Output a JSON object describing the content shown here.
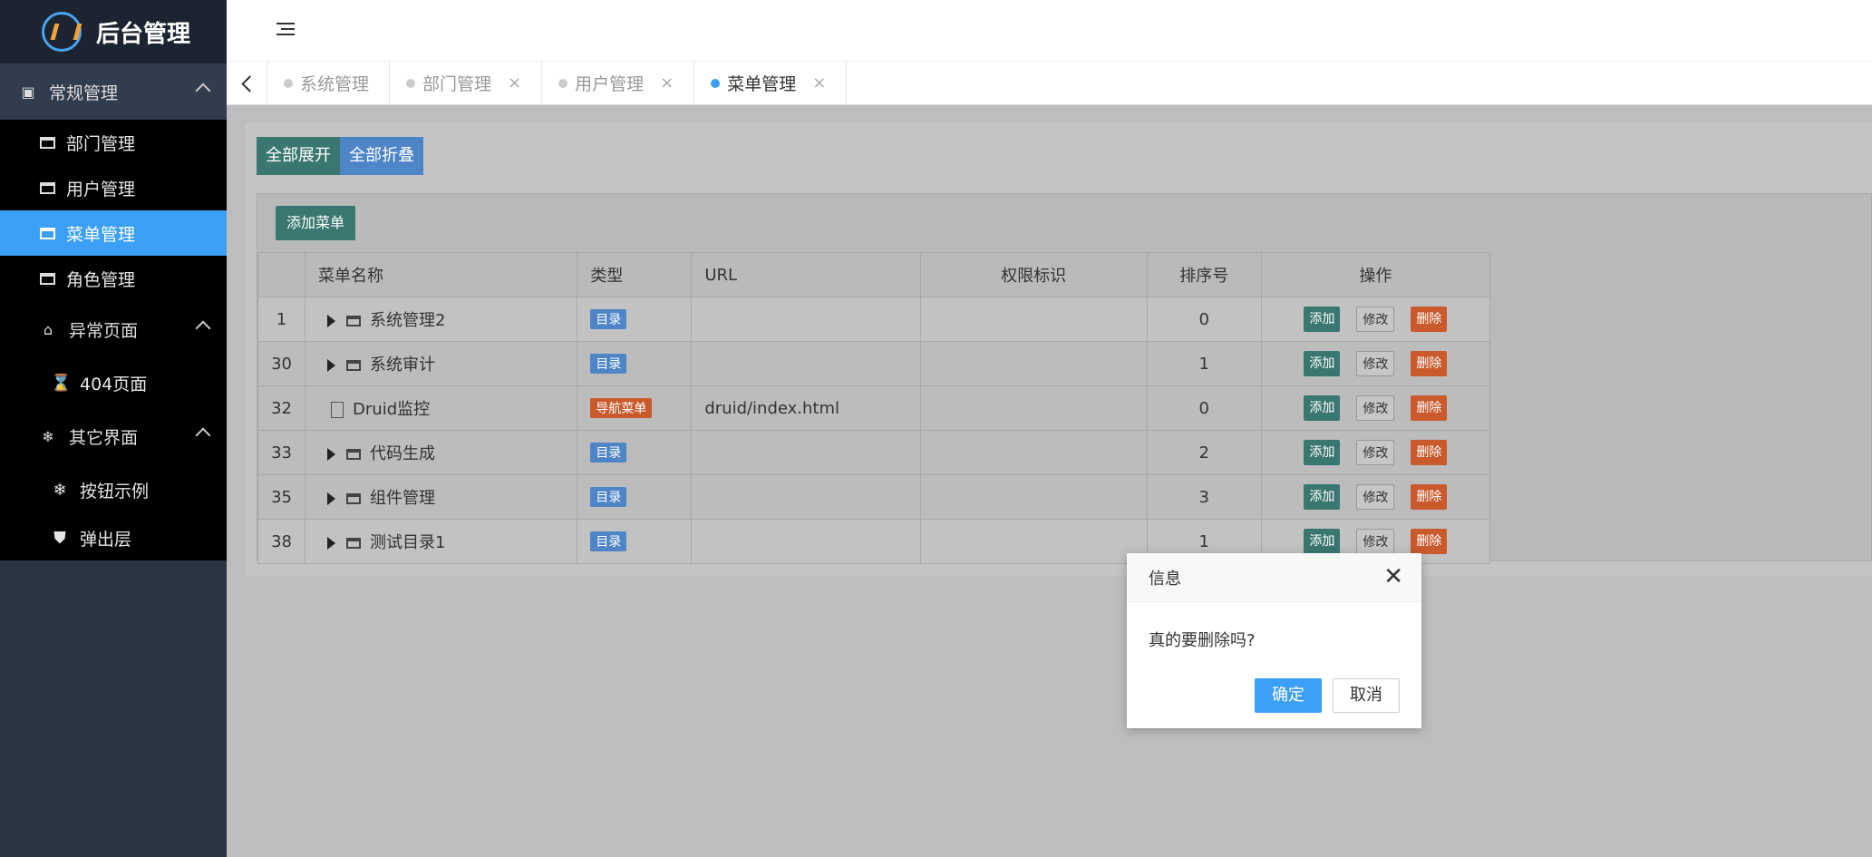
{
  "app": {
    "title": "后台管理"
  },
  "sidebar": {
    "groups": [
      {
        "label": "常规管理",
        "icon": "address-card-icon"
      },
      {
        "label": "异常页面",
        "icon": "home-icon"
      },
      {
        "label": "其它界面",
        "icon": "snowflake-icon"
      }
    ],
    "items": [
      {
        "label": "部门管理"
      },
      {
        "label": "用户管理"
      },
      {
        "label": "菜单管理"
      },
      {
        "label": "角色管理"
      },
      {
        "label": "404页面",
        "icon": "hourglass-icon"
      },
      {
        "label": "按钮示例",
        "icon": "snowflake-icon"
      },
      {
        "label": "弹出层",
        "icon": "shield-icon"
      }
    ]
  },
  "tabs": [
    {
      "label": "系统管理"
    },
    {
      "label": "部门管理"
    },
    {
      "label": "用户管理"
    },
    {
      "label": "菜单管理"
    }
  ],
  "toolbar": {
    "expand_all": "全部展开",
    "collapse_all": "全部折叠",
    "add_menu": "添加菜单"
  },
  "table": {
    "columns": [
      "菜单名称",
      "类型",
      "URL",
      "权限标识",
      "排序号",
      "操作"
    ],
    "rows": [
      {
        "id": "1",
        "name": "系统管理2",
        "type": "目录",
        "url": "",
        "perm": "",
        "order": "0"
      },
      {
        "id": "30",
        "name": "系统审计",
        "type": "目录",
        "url": "",
        "perm": "",
        "order": "1"
      },
      {
        "id": "32",
        "name": "Druid监控",
        "type": "导航菜单",
        "url": "druid/index.html",
        "perm": "",
        "order": "0"
      },
      {
        "id": "33",
        "name": "代码生成",
        "type": "目录",
        "url": "",
        "perm": "",
        "order": "2"
      },
      {
        "id": "35",
        "name": "组件管理",
        "type": "目录",
        "url": "",
        "perm": "",
        "order": "3"
      },
      {
        "id": "38",
        "name": "测试目录1",
        "type": "目录",
        "url": "",
        "perm": "",
        "order": "1"
      }
    ],
    "ops": {
      "add": "添加",
      "edit": "修改",
      "delete": "删除"
    }
  },
  "modal": {
    "title": "信息",
    "message": "真的要删除吗?",
    "ok": "确定",
    "cancel": "取消"
  },
  "colors": {
    "accent": "#3a9ff5",
    "teal": "#3a7770",
    "danger": "#c85a2c"
  }
}
